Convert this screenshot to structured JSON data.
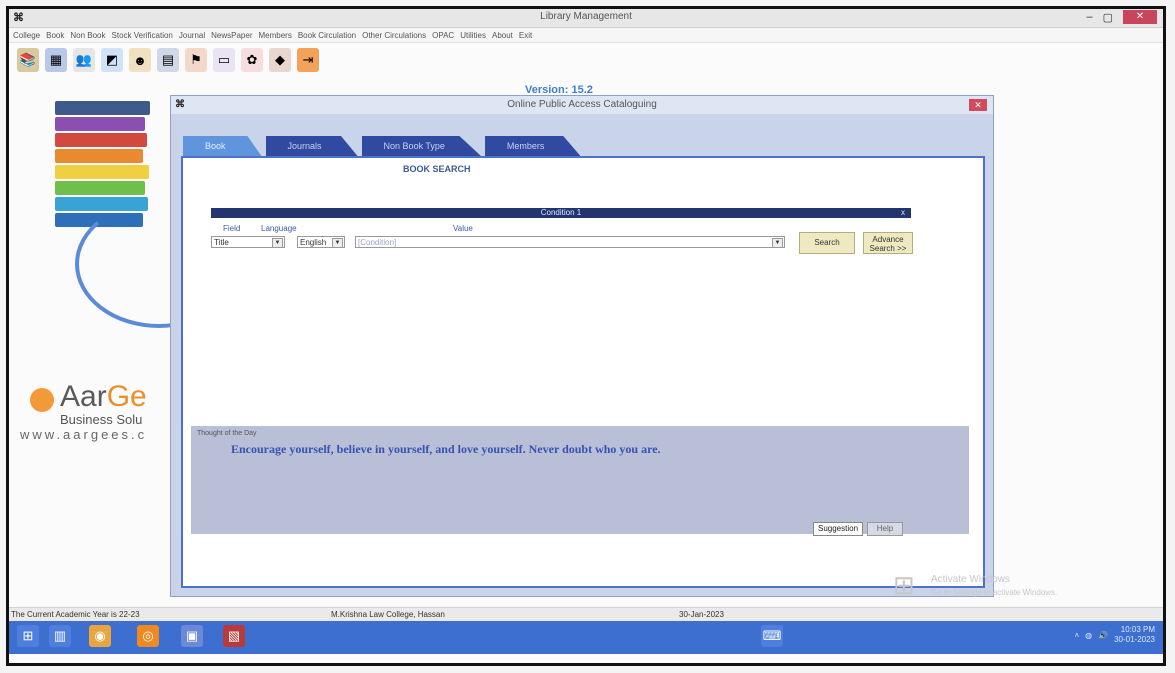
{
  "window": {
    "title": "Library Management",
    "app_icon": "app-icon"
  },
  "menu": [
    "College",
    "Book",
    "Non Book",
    "Stock Verification",
    "Journal",
    "NewsPaper",
    "Members",
    "Book Circulation",
    "Other Circulations",
    "OPAC",
    "Utilities",
    "About",
    "Exit"
  ],
  "toolbar_icons": [
    "book-icon",
    "calendar-icon",
    "members-icon",
    "chart-icon",
    "user-icon",
    "report-icon",
    "flag-icon",
    "document-icon",
    "gift-icon",
    "journal-icon",
    "exit-icon"
  ],
  "version_label": "Version: 15.2",
  "logo": {
    "name_left": "Aar",
    "name_right": "Ge",
    "sub": "Business Solu",
    "url": "www.aargees.c"
  },
  "dialog": {
    "title": "Online Public Access Cataloguing",
    "tabs": [
      "Book",
      "Journals",
      "Non Book Type",
      "Members"
    ],
    "heading": "BOOK SEARCH",
    "condition_label": "Condition 1",
    "condition_close": "x",
    "field_label": "Field",
    "language_label": "Language",
    "value_label": "Value",
    "field_value": "Title",
    "language_value": "English",
    "value_placeholder": "[Condition]",
    "search_button": "Search",
    "advance_button": "Advance Search >>",
    "thought_caption": "Thought of the Day",
    "thought_text": "Encourage yourself, believe in yourself, and love yourself. Never doubt who you are.",
    "suggestion_button": "Suggestion",
    "help_button": "Help"
  },
  "watermark": {
    "line1": "Activate Windows",
    "line2": "Go to Settings to activate Windows."
  },
  "status": {
    "academic": "The Current Academic Year is 22-23",
    "college": "M.Krishna Law College, Hassan",
    "date": "30-Jan-2023"
  },
  "tray": {
    "time": "10:03 PM",
    "date": "30-01-2023"
  },
  "colors": {
    "tab_active": "#5e95dc",
    "tab_inactive": "#2f4aa0",
    "panel_border": "#4a73c9",
    "taskbar": "#3d6fd0"
  }
}
